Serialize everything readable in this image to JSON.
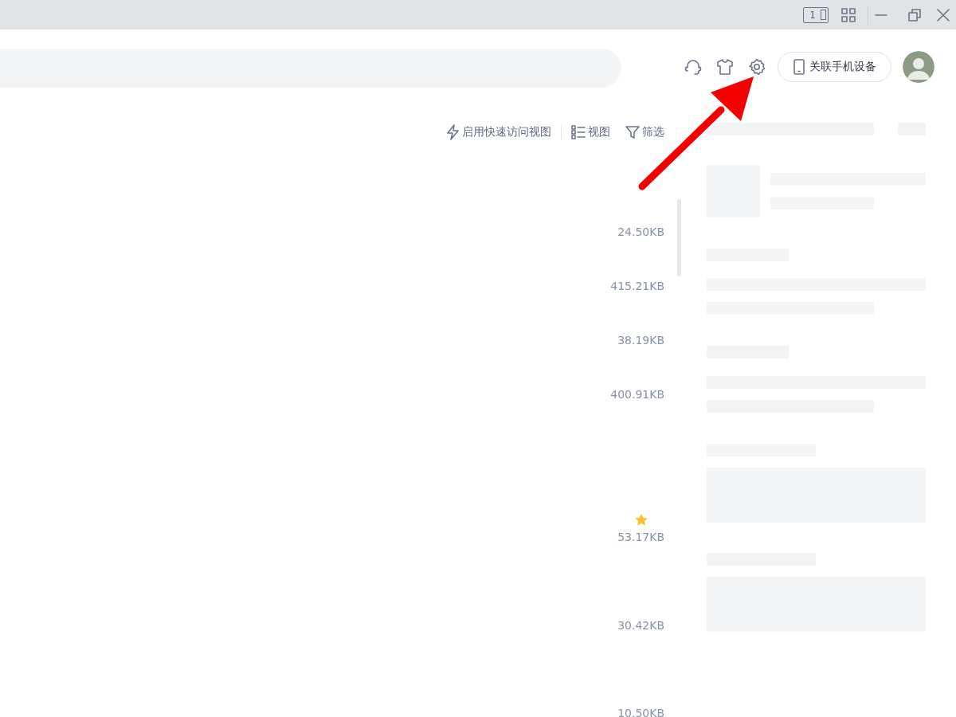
{
  "title_bar": {
    "device_badge": "1"
  },
  "header": {
    "link_phone_button": "关联手机设备"
  },
  "toolbar": [
    {
      "kind": "quick",
      "label": "启用快速访问视图"
    },
    {
      "kind": "view",
      "label": "视图"
    },
    {
      "kind": "filter",
      "label": "筛选"
    }
  ],
  "files": [
    {
      "size": "24.50KB",
      "starred": false
    },
    {
      "size": "415.21KB",
      "starred": false
    },
    {
      "size": "38.19KB",
      "starred": false
    },
    {
      "size": "400.91KB",
      "starred": false
    },
    {
      "size": "53.17KB",
      "starred": true
    },
    {
      "size": "30.42KB",
      "starred": false
    },
    {
      "size": "10.50KB",
      "starred": false
    }
  ]
}
